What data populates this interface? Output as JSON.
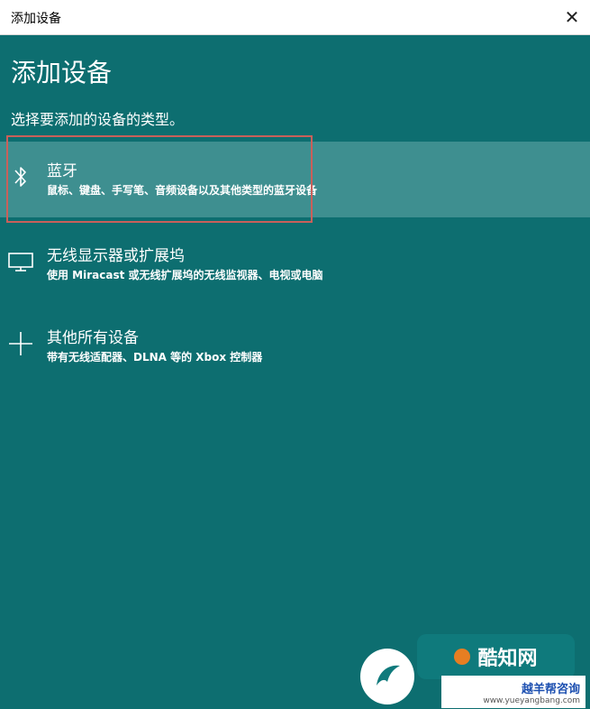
{
  "window": {
    "title": "添加设备",
    "close_glyph": "✕"
  },
  "page": {
    "heading": "添加设备",
    "subtitle": "选择要添加的设备的类型。"
  },
  "options": [
    {
      "label": "蓝牙",
      "description": "鼠标、键盘、手写笔、音频设备以及其他类型的蓝牙设备",
      "icon": "bluetooth-icon",
      "selected": true
    },
    {
      "label": "无线显示器或扩展坞",
      "description": "使用 Miracast 或无线扩展坞的无线监视器、电视或电脑",
      "icon": "monitor-icon",
      "selected": false
    },
    {
      "label": "其他所有设备",
      "description": "带有无线适配器、DLNA 等的 Xbox 控制器",
      "icon": "plus-icon",
      "selected": false
    }
  ],
  "watermark": {
    "brand": "酷知网",
    "site_name": "越羊帮咨询",
    "site_url": "www.yueyangbang.com"
  },
  "colors": {
    "panel_bg": "#0d6e70",
    "selected_bg": "#3e8f90",
    "highlight_border": "#c9605a"
  }
}
